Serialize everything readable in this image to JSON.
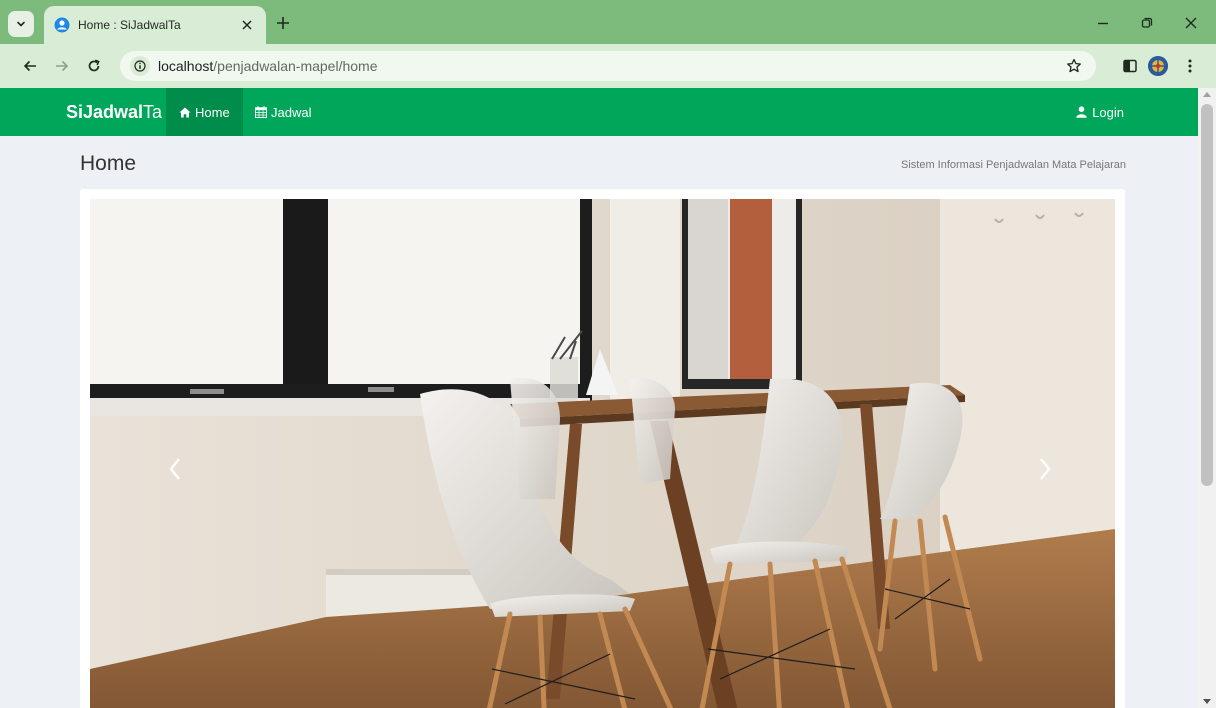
{
  "browser": {
    "tab_title": "Home : SiJadwalTa",
    "url_host": "localhost",
    "url_path": "/penjadwalan-mapel/home"
  },
  "app": {
    "brand_bold": "SiJadwal",
    "brand_light": "Ta",
    "nav": [
      {
        "label": "Home",
        "icon": "home-icon",
        "active": true
      },
      {
        "label": "Jadwal",
        "icon": "calendar-icon",
        "active": false
      }
    ],
    "login_label": "Login",
    "accent": "#00a65a"
  },
  "page": {
    "title": "Home",
    "subtitle": "Sistem Informasi Penjadwalan Mata Pelajaran"
  },
  "carousel": {
    "image_subject": "dining-room-photo"
  }
}
